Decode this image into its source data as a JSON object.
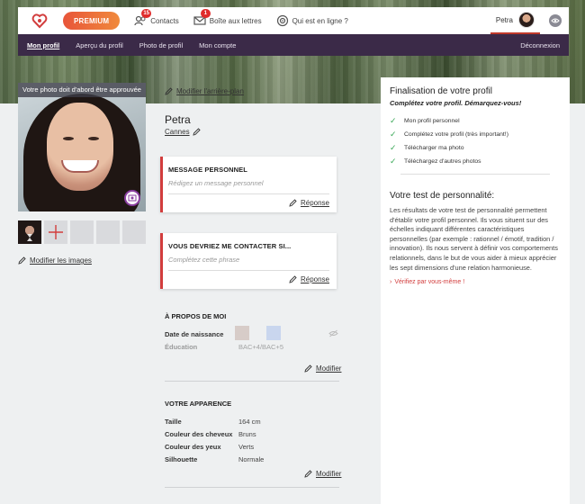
{
  "header": {
    "premium_label": "PREMIUM",
    "contacts_label": "Contacts",
    "contacts_count": "15",
    "mailbox_label": "Boîte aux lettres",
    "mailbox_count": "1",
    "online_label": "Qui est en ligne ?",
    "user_name": "Petra"
  },
  "subnav": {
    "items": [
      "Mon profil",
      "Aperçu du profil",
      "Photo de profil",
      "Mon compte"
    ],
    "logout": "Déconnexion"
  },
  "photo": {
    "notice": "Votre photo doit d'abord être approuvée",
    "modify_images": "Modifier les images"
  },
  "profile": {
    "modify_background": "Modifier l'arrière-plan",
    "name": "Petra",
    "city": "Cannes"
  },
  "cards": [
    {
      "title": "MESSAGE PERSONNEL",
      "placeholder": "Rédigez un message personnel",
      "reply": "Réponse"
    },
    {
      "title": "VOUS DEVRIEZ ME CONTACTER SI...",
      "placeholder": "Complétez cette phrase",
      "reply": "Réponse"
    }
  ],
  "about": {
    "title": "À PROPOS DE MOI",
    "rows": [
      {
        "k": "Date de naissance",
        "v": ""
      },
      {
        "k": "Éducation",
        "v": "BAC+4/BAC+5"
      }
    ],
    "modify": "Modifier"
  },
  "appearance": {
    "title": "VOTRE APPARENCE",
    "rows": [
      {
        "k": "Taille",
        "v": "164 cm"
      },
      {
        "k": "Couleur des cheveux",
        "v": "Bruns"
      },
      {
        "k": "Couleur des yeux",
        "v": "Verts"
      },
      {
        "k": "Silhouette",
        "v": "Normale"
      }
    ],
    "modify": "Modifier"
  },
  "sidebar": {
    "title": "Finalisation de votre profil",
    "subtitle": "Complétez votre profil. Démarquez-vous!",
    "checks": [
      "Mon profil personnel",
      "Complétez votre profil (très important!)",
      "Télécharger ma photo",
      "Téléchargez d'autres photos"
    ],
    "test_title": "Votre test de personnalité:",
    "test_text": "Les résultats de votre test de personnalité permettent d'établir votre profil personnel. Ils vous situent sur des échelles indiquant différentes caractéristiques personnelles (par exemple : rationnel / émotif, tradition / innovation). Ils nous servent à définir vos comportements relationnels, dans le but de vous aider à mieux apprécier les sept dimensions d'une relation harmonieuse.",
    "verify": "Vérifiez par vous-même !"
  },
  "colors": {
    "accent": "#d23d3d",
    "subnav_bg": "#3b2a48",
    "check": "#3aa757"
  }
}
